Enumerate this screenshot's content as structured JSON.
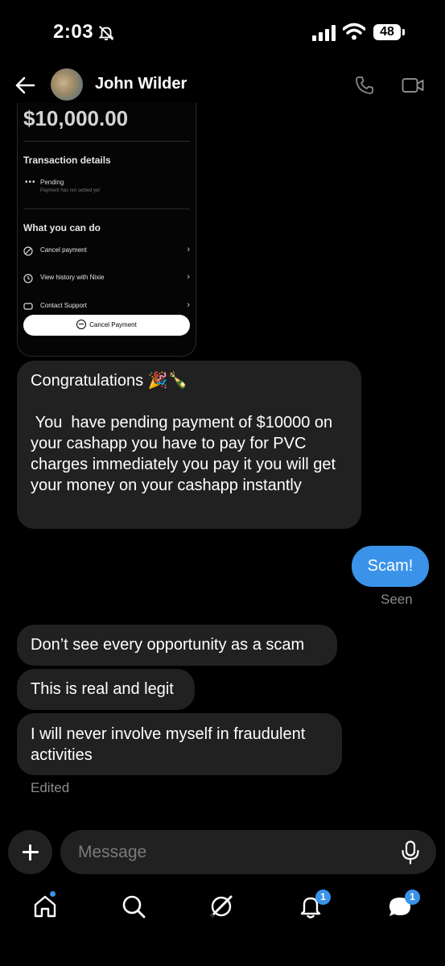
{
  "status_bar": {
    "time": "2:03",
    "battery": "48"
  },
  "header": {
    "contact_name": "John Wilder"
  },
  "screenshot": {
    "amount": "$10,000.00",
    "transaction_title": "Transaction details",
    "pending_label": "Pending",
    "pending_sub": "Payment has not settled yet",
    "actions_title": "What you can do",
    "actions": [
      "Cancel payment",
      "View history with Nixie",
      "Contact Support"
    ],
    "cancel_button": "Cancel Payment"
  },
  "messages": {
    "incoming_long": "Congratulations 🎉🍾\n\n You  have pending payment of $10000 on your cashapp you have to pay for PVC charges immediately you pay it you will get your money on your cashapp instantly",
    "outgoing": "Scam!",
    "seen": "Seen",
    "incoming_1": "Don’t see every opportunity as a scam",
    "incoming_2": "This is real and legit",
    "incoming_3": "I will never involve myself in fraudulent activities",
    "edited": "Edited"
  },
  "composer": {
    "placeholder": "Message"
  },
  "tab_bar": {
    "notifications_badge": "1",
    "messages_badge": "1"
  },
  "colors": {
    "accent": "#3b93e9",
    "bubble_incoming": "#212121",
    "background": "#000000"
  }
}
